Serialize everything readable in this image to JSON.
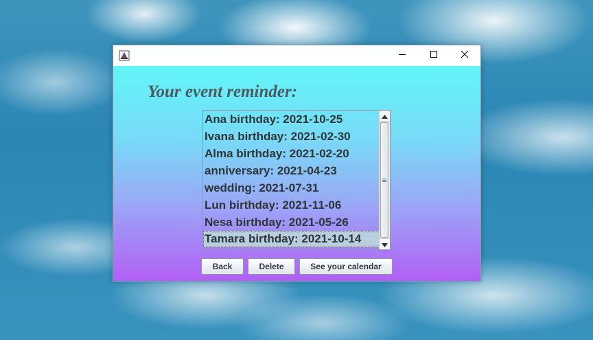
{
  "window": {
    "icon": "java-app-icon",
    "controls": {
      "minimize": "minimize-icon",
      "maximize": "maximize-icon",
      "close": "close-icon"
    }
  },
  "heading": "Your event reminder:",
  "events": [
    "Ana birthday: 2021-10-25",
    "Ivana birthday: 2021-02-30",
    "Alma birthday: 2021-02-20",
    "anniversary: 2021-04-23",
    "wedding: 2021-07-31",
    "Lun birthday: 2021-11-06",
    "Nesa birthday: 2021-05-26",
    "Tamara birthday: 2021-10-14"
  ],
  "selected_event": "Tamara birthday: 2021-10-14",
  "buttons": {
    "back": "Back",
    "delete": "Delete",
    "calendar": "See your calendar"
  },
  "colors": {
    "gradient_top": "#62f6f8",
    "gradient_bottom": "#b25ff6",
    "selection": "#b8cfe0"
  }
}
